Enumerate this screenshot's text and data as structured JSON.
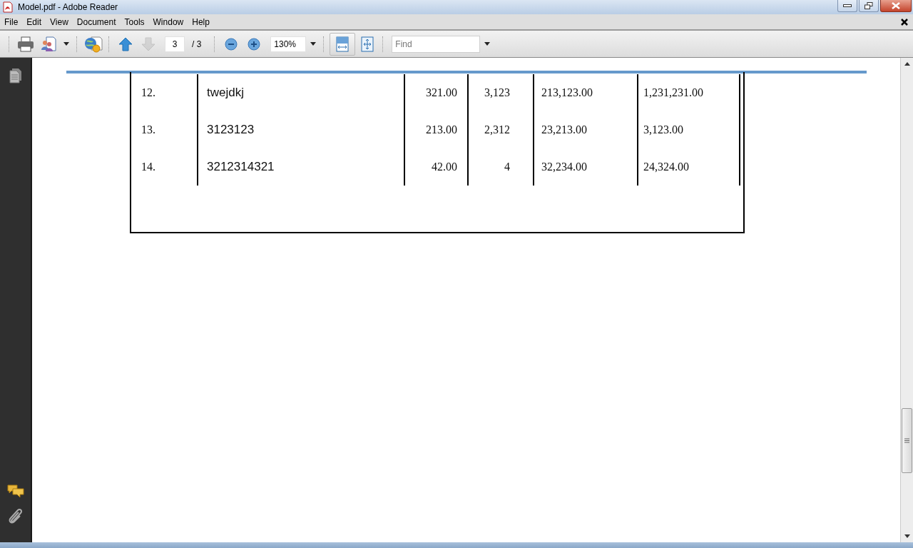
{
  "window": {
    "title": "Model.pdf - Adobe Reader"
  },
  "menu": [
    "File",
    "Edit",
    "View",
    "Document",
    "Tools",
    "Window",
    "Help"
  ],
  "toolbar": {
    "nav": [
      {
        "kind": "up",
        "disabled": false
      },
      {
        "kind": "down",
        "disabled": true
      }
    ],
    "page_number": "3",
    "page_total": "/ 3",
    "zoom": "130%",
    "view_modes": [
      {
        "kind": "fit-width",
        "selected": true
      },
      {
        "kind": "fit-page",
        "selected": false
      }
    ],
    "find": {
      "placeholder": "Find"
    }
  },
  "table": {
    "rows": [
      {
        "cells": [
          "12.",
          "twejdkj",
          "321.00",
          "3,123",
          "213,123.00",
          "1,231,231.00"
        ]
      },
      {
        "cells": [
          "13.",
          "3123123",
          "213.00",
          "2,312",
          "23,213.00",
          "3,123.00"
        ]
      },
      {
        "cells": [
          "14.",
          "3212314321",
          "42.00",
          "4",
          "32,234.00",
          "24,324.00"
        ]
      }
    ]
  }
}
